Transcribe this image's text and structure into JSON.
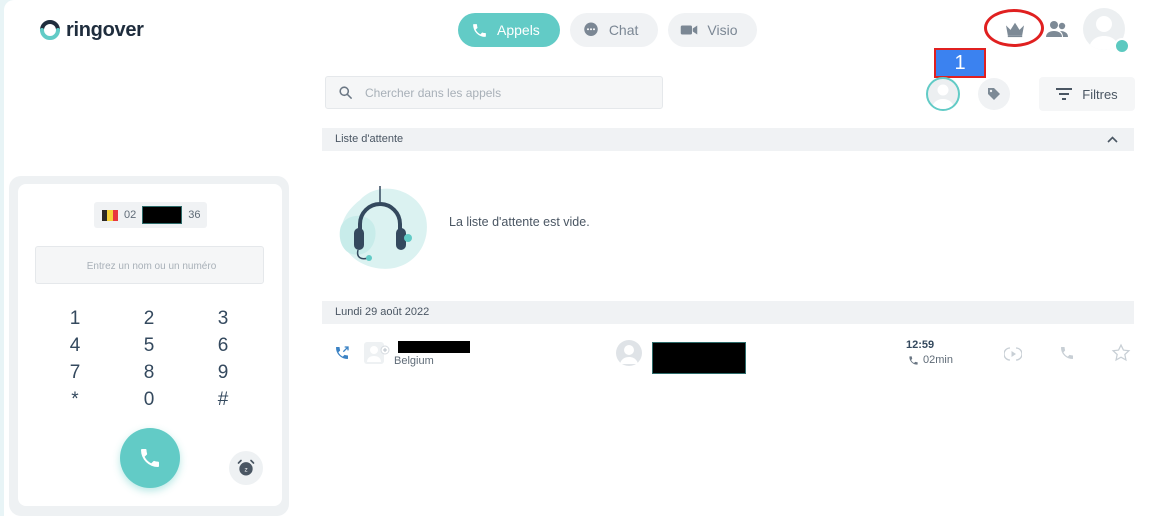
{
  "brand": {
    "name": "ringover",
    "accent": "#62cbc6"
  },
  "nav": {
    "tabs": [
      {
        "label": "Appels",
        "icon": "phone-icon",
        "active": true
      },
      {
        "label": "Chat",
        "icon": "chat-bubble-icon",
        "active": false
      },
      {
        "label": "Visio",
        "icon": "video-camera-icon",
        "active": false
      }
    ]
  },
  "annotation": {
    "label": "1"
  },
  "search": {
    "placeholder": "Chercher dans les appels"
  },
  "filters": {
    "label": "Filtres"
  },
  "queue": {
    "header": "Liste d'attente",
    "empty_message": "La liste d'attente est vide."
  },
  "history": {
    "date_header": "Lundi 29 août 2022",
    "calls": [
      {
        "country": "Belgium",
        "time": "12:59",
        "duration": "02min",
        "direction_icon": "outgoing-call-icon"
      }
    ]
  },
  "dialer": {
    "caller_id_prefix": "02",
    "caller_id_suffix": "36",
    "input_placeholder": "Entrez un nom ou un numéro",
    "keys": [
      "1",
      "2",
      "3",
      "4",
      "5",
      "6",
      "7",
      "8",
      "9",
      "*",
      "0",
      "#"
    ]
  }
}
